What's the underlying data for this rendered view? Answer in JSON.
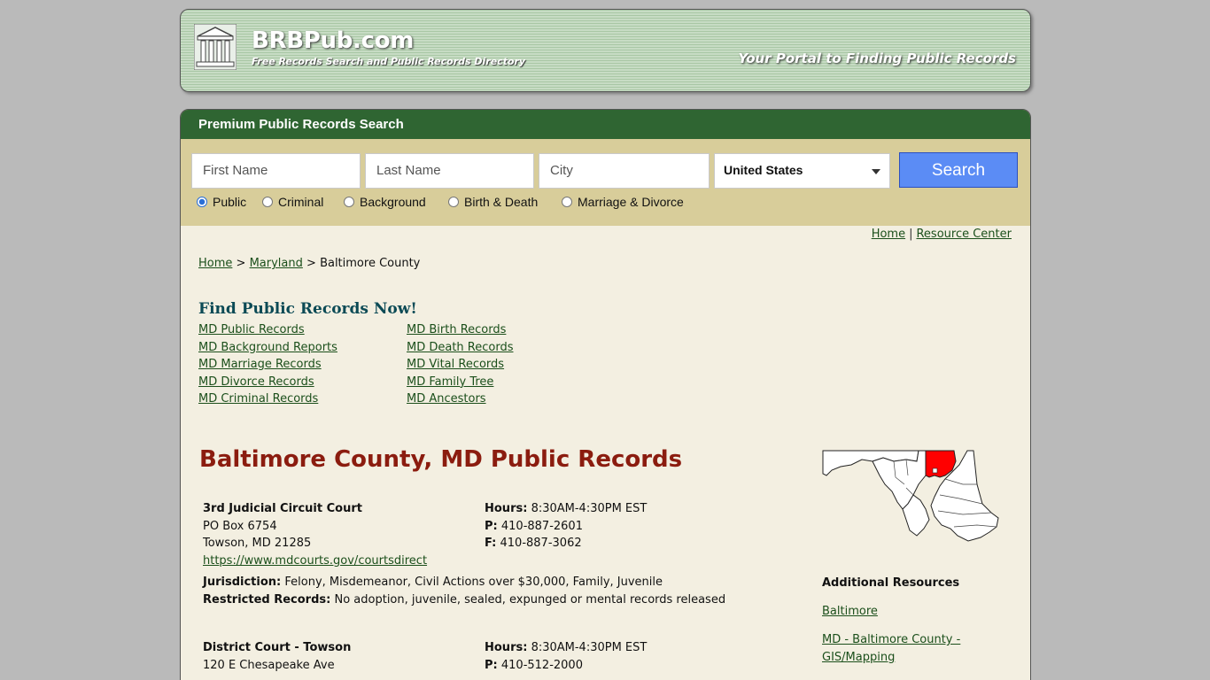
{
  "header": {
    "brand": "BRBPub.com",
    "tagline": "Free Records Search and Public Records Directory",
    "portal": "Your Portal to Finding Public Records"
  },
  "search": {
    "title": "Premium Public Records Search",
    "first_name_placeholder": "First Name",
    "last_name_placeholder": "Last Name",
    "city_placeholder": "City",
    "country_selected": "United States",
    "button_label": "Search",
    "radios": [
      {
        "label": "Public",
        "selected": true
      },
      {
        "label": "Criminal",
        "selected": false
      },
      {
        "label": "Background",
        "selected": false
      },
      {
        "label": "Birth & Death",
        "selected": false
      },
      {
        "label": "Marriage & Divorce",
        "selected": false
      }
    ]
  },
  "toplinks": {
    "home": "Home",
    "sep": "|",
    "resource_center": "Resource Center"
  },
  "breadcrumb": {
    "home": "Home",
    "gt1": ">",
    "state": "Maryland",
    "gt2": ">",
    "current": "Baltimore County"
  },
  "find": {
    "title": "Find Public Records Now!",
    "left": [
      "MD Public Records",
      "MD Background Reports",
      "MD Marriage Records",
      "MD Divorce Records",
      "MD Criminal Records"
    ],
    "right": [
      "MD Birth Records",
      "MD Death Records",
      "MD Vital Records",
      "MD Family Tree",
      "MD Ancestors"
    ]
  },
  "page_title": "Baltimore County, MD Public Records",
  "courts": [
    {
      "name": "3rd Judicial Circuit Court",
      "address1": "PO Box 6754",
      "address2": "Towson, MD 21285",
      "url": "https://www.mdcourts.gov/courtsdirect",
      "hours_label": "Hours:",
      "hours": "8:30AM-4:30PM EST",
      "phone_label": "P:",
      "phone": "410-887-2601",
      "fax_label": "F:",
      "fax": "410-887-3062",
      "jurisdiction_label": "Jurisdiction:",
      "jurisdiction": "Felony, Misdemeanor, Civil Actions over $30,000, Family, Juvenile",
      "restricted_label": "Restricted Records:",
      "restricted": "No adoption, juvenile, sealed, expunged or mental records released"
    },
    {
      "name": "District Court - Towson",
      "address1": "120 E Chesapeake Ave",
      "hours_label": "Hours:",
      "hours": "8:30AM-4:30PM EST",
      "phone_label": "P:",
      "phone": "410-512-2000"
    }
  ],
  "additional": {
    "title": "Additional Resources",
    "links": [
      "Baltimore",
      "MD - Baltimore County - GIS/Mapping"
    ]
  },
  "colors": {
    "header_green": "#2f6532",
    "title_red": "#8b1c0f",
    "search_blue": "#5b8cf5",
    "county_highlight": "#ff0000"
  }
}
